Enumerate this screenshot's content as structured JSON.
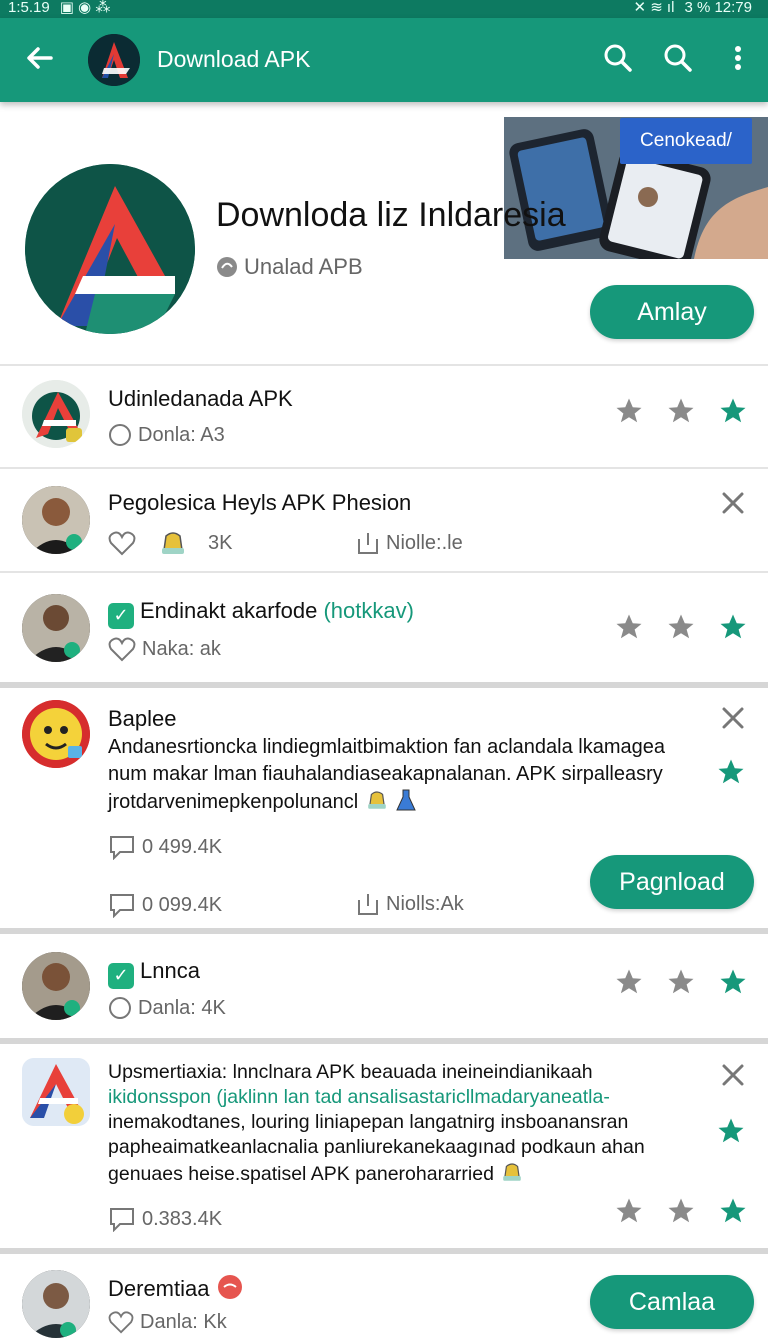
{
  "status": {
    "time_left": "1:5.19",
    "right": "3 %  12:79"
  },
  "appbar": {
    "title": "Download APK",
    "icons": [
      "back-arrow-icon",
      "search-icon",
      "search-icon",
      "more-vert-icon"
    ]
  },
  "hero": {
    "title": "Downloda liz Inldaresia",
    "subtitle": "Unalad APB",
    "banner_button": "Cenokead/",
    "action_button": "Amlay"
  },
  "rows": [
    {
      "title": "Udinledanada APK",
      "meta": "Donla: A3"
    },
    {
      "title": "Pegolesica Heyls APK Phesion",
      "meta_count": "3K",
      "meta_right": "Niolle:.le"
    },
    {
      "title": "Endinakt akarfode",
      "title_green": "(hotkkav)",
      "meta": "Naka: ak"
    },
    {
      "title": "Baplee",
      "text": "Andanesrtioncka lindiegmlaitbimaktion fan aclandala lkamagea num makar lman fiauhalandiaseakapnalanan. APK sirpalleasry jrotdarvenimepkenpolunancl",
      "meta_1": "0 499.4K",
      "meta_2": "0 099.4K",
      "meta_right": "Niolls:Ak",
      "button": "Pagnload"
    },
    {
      "title": "Lnnca",
      "meta": "Danla: 4K"
    },
    {
      "text_1": "Upsmertiaxia: lnnclnara APK beauada ineineindianikaah",
      "text_2_black": "ikidonsspon (jaklinn lan tad ansalisastaricll",
      "text_2_green": "madaryaneatla-",
      "text_3": "inemakodtanes, louring liniapepan langatnirg insboanansran papheaimatkeanlacnalia panliurekanekaagınad podkaun ahan genuaes heise.spatisel APK panerohararried",
      "meta": "0.383.4K"
    },
    {
      "title": "Deremtiaa",
      "meta": "Danla: Kk",
      "button": "Camlaa"
    }
  ],
  "colors": {
    "primary": "#16987a",
    "statusbar": "#0d7a61",
    "star_active": "#16987a",
    "star_inactive": "#8a8a8a",
    "banner_button": "#2b63c9"
  }
}
